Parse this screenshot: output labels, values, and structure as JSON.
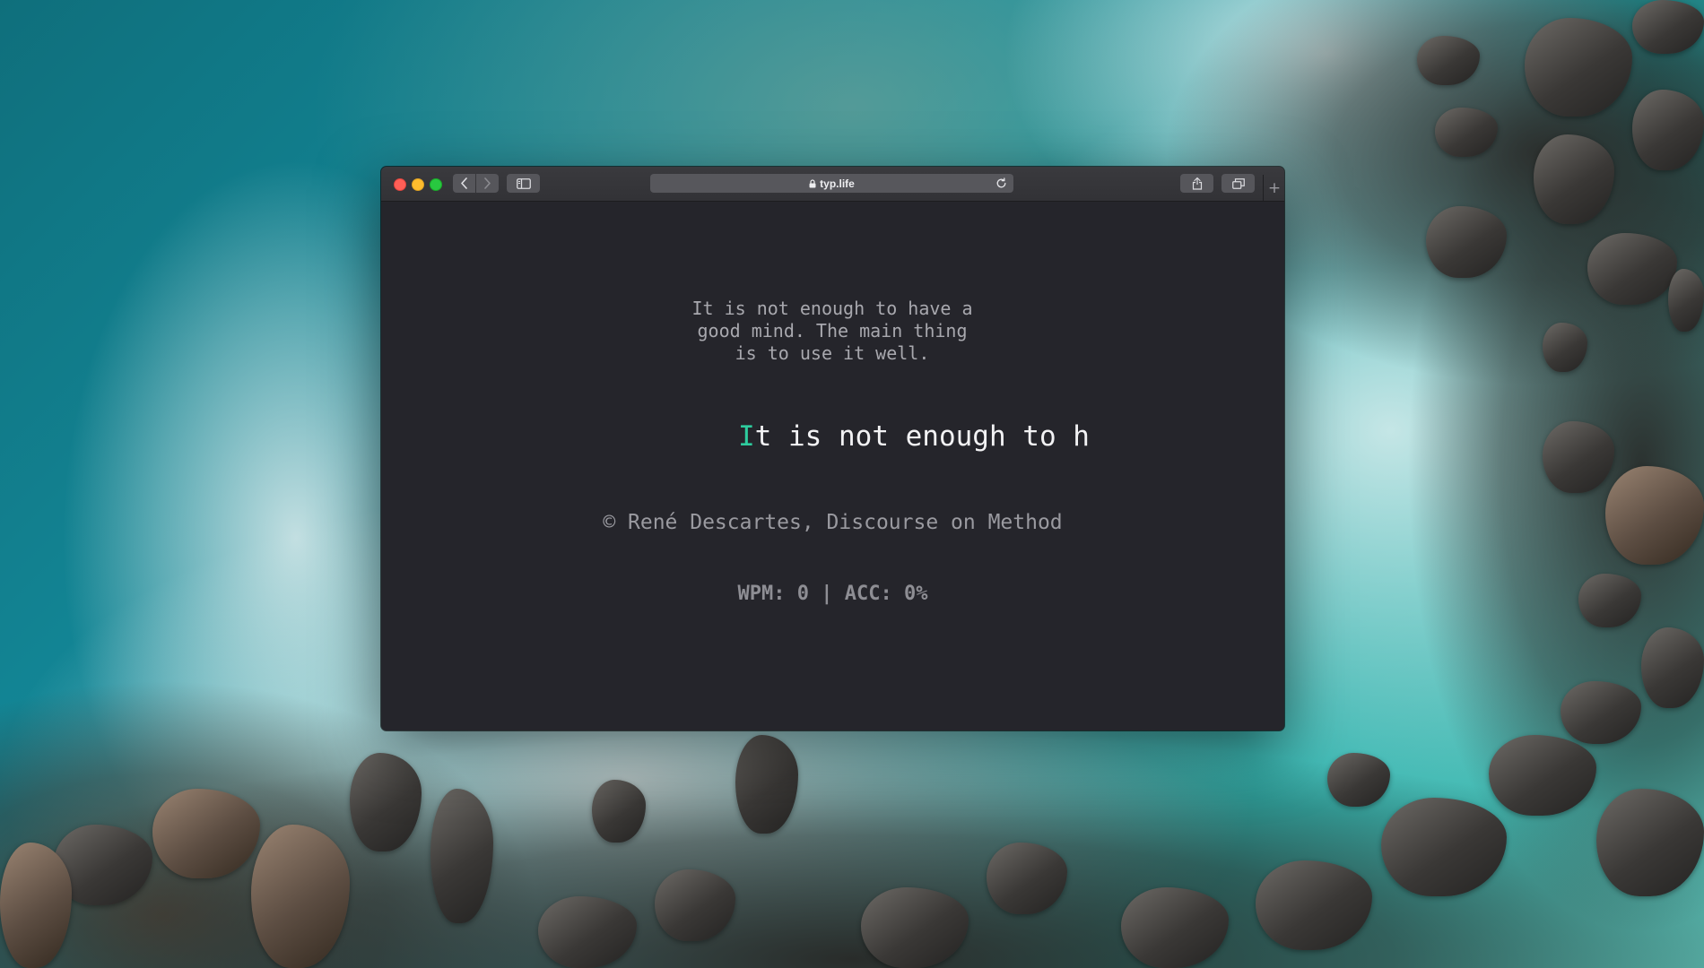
{
  "browser": {
    "url": "typ.life",
    "nav_back_icon": "chevron-left-icon",
    "nav_forward_icon": "chevron-right-icon",
    "sidebar_icon": "sidebar-icon",
    "share_icon": "share-icon",
    "tabs_icon": "tabs-overview-icon",
    "new_tab_label": "+",
    "colors": {
      "close": "#fe5f57",
      "minimize": "#febc2e",
      "zoom": "#28c840",
      "page_background": "#25252b"
    }
  },
  "typing_test": {
    "quote": "It is not enough to have a\ngood mind. The main thing\nis to use it well.",
    "current_char": "I",
    "remaining_text": "t is not enough to h",
    "attribution": "© René Descartes, Discourse on Method",
    "stats": "WPM: 0 | ACC: 0%",
    "cursor_color": "#2ecc9e"
  }
}
